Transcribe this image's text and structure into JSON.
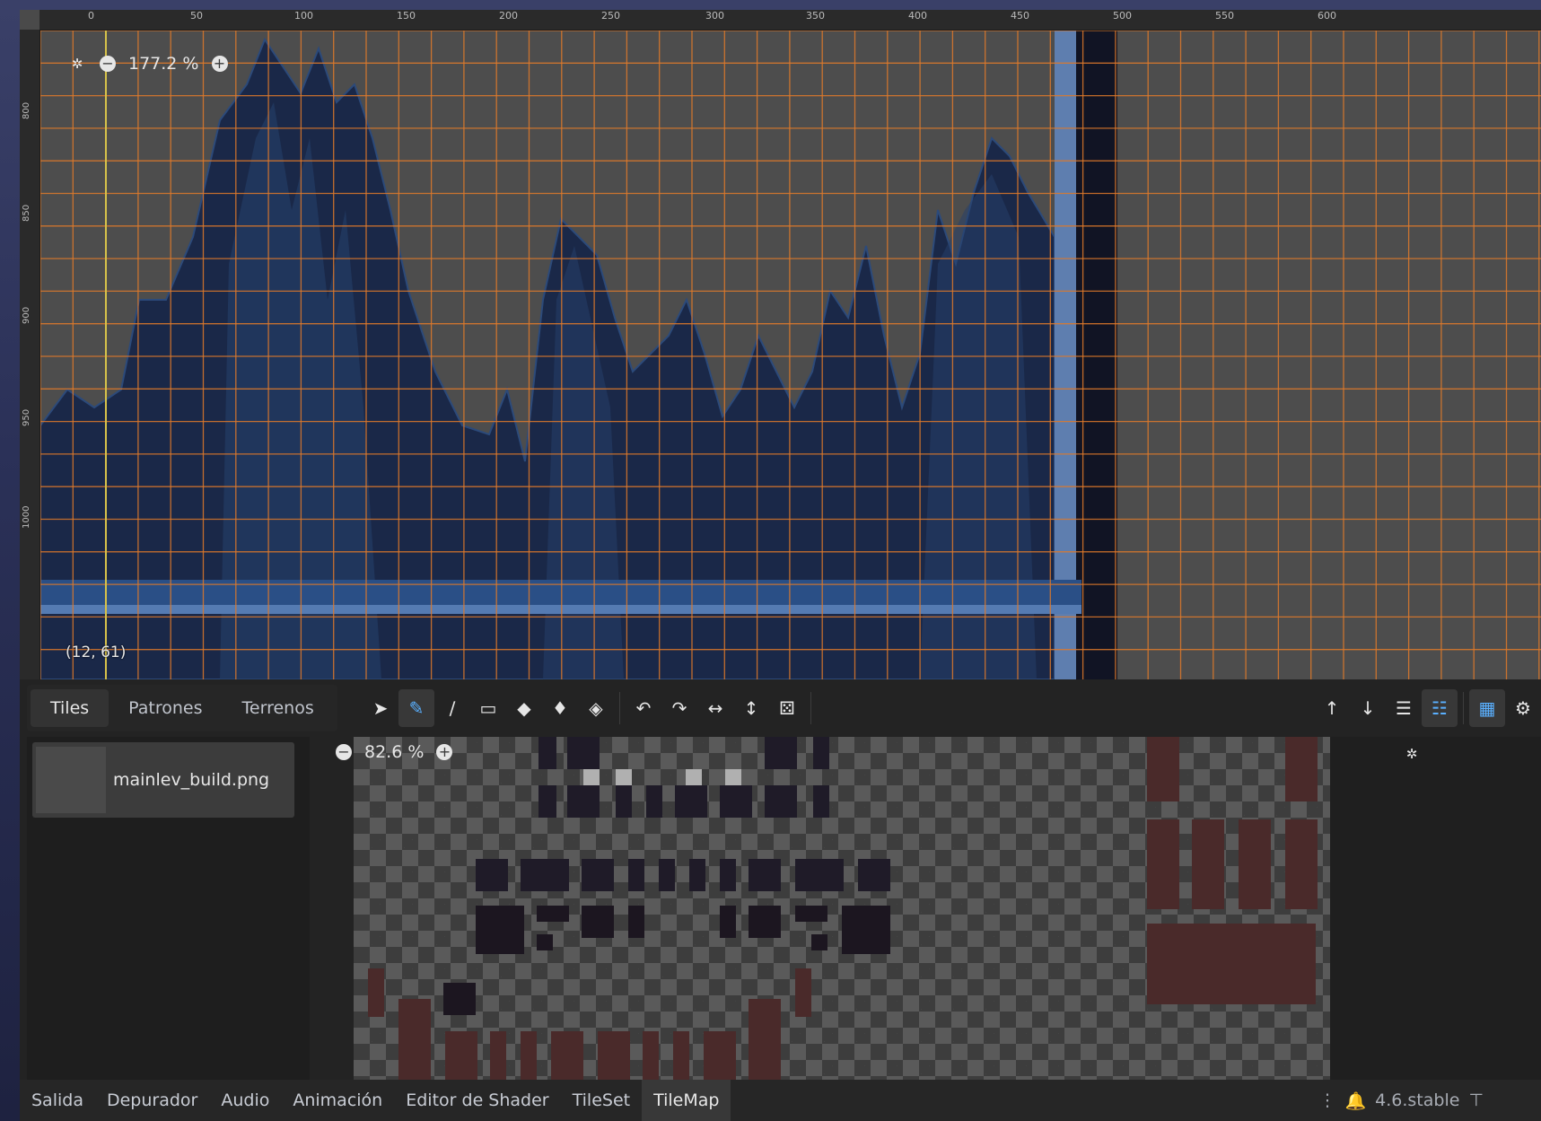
{
  "viewport": {
    "zoom": "177.2 %",
    "cursor_coord": "(12, 61)",
    "ruler_top": [
      "0",
      "50",
      "100",
      "150",
      "200",
      "250",
      "300",
      "350",
      "400",
      "450",
      "500",
      "550",
      "600"
    ],
    "ruler_left": [
      "800",
      "850",
      "900",
      "950",
      "1000"
    ]
  },
  "tile_panel": {
    "tabs": [
      "Tiles",
      "Patrones",
      "Terrenos"
    ],
    "active_tab": "Tiles",
    "source_name": "mainlev_build.png",
    "atlas_zoom": "82.6 %"
  },
  "tools": {
    "left": [
      "select-icon",
      "paint-icon",
      "line-icon",
      "rect-icon",
      "bucket-icon",
      "picker-icon",
      "eraser-icon"
    ],
    "middle": [
      "rotate-left-icon",
      "rotate-right-icon",
      "flip-h-icon",
      "flip-v-icon",
      "random-icon"
    ],
    "right": [
      "move-up-icon",
      "move-down-icon",
      "list-icon",
      "layers-icon",
      "grid-icon",
      "settings-icon"
    ]
  },
  "dock": {
    "tabs": [
      "Salida",
      "Depurador",
      "Audio",
      "Animación",
      "Editor de Shader",
      "TileSet",
      "TileMap"
    ],
    "active_tab": "TileMap",
    "version": "4.6.stable"
  },
  "colors": {
    "grid": "#e07a2a",
    "mountains": "#1a2a48",
    "accent": "#5ab0ff"
  }
}
